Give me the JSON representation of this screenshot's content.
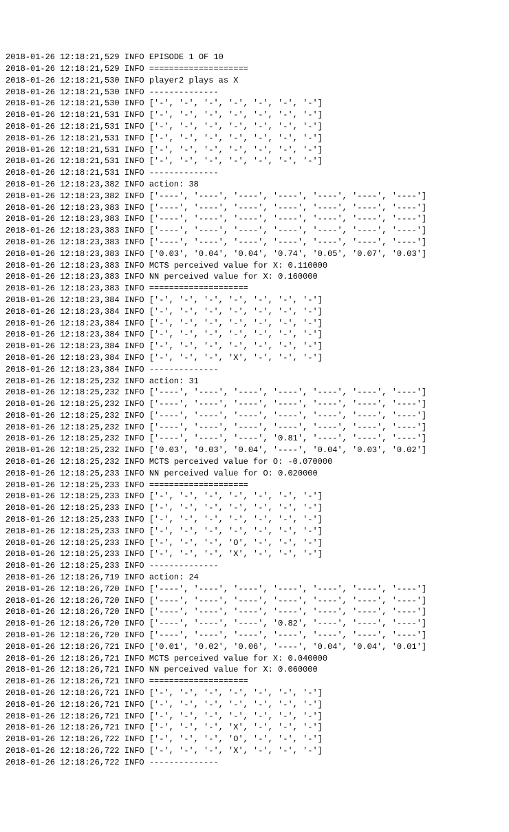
{
  "lines": [
    {
      "ts": "2018-01-26 12:18:21,529",
      "level": "INFO",
      "msg": "EPISODE 1 OF 10"
    },
    {
      "ts": "2018-01-26 12:18:21,529",
      "level": "INFO",
      "msg": "===================="
    },
    {
      "ts": "2018-01-26 12:18:21,530",
      "level": "INFO",
      "msg": "player2 plays as X"
    },
    {
      "ts": "2018-01-26 12:18:21,530",
      "level": "INFO",
      "msg": "--------------"
    },
    {
      "ts": "2018-01-26 12:18:21,530",
      "level": "INFO",
      "msg": "['-', '-', '-', '-', '-', '-', '-']"
    },
    {
      "ts": "2018-01-26 12:18:21,531",
      "level": "INFO",
      "msg": "['-', '-', '-', '-', '-', '-', '-']"
    },
    {
      "ts": "2018-01-26 12:18:21,531",
      "level": "INFO",
      "msg": "['-', '-', '-', '-', '-', '-', '-']"
    },
    {
      "ts": "2018-01-26 12:18:21,531",
      "level": "INFO",
      "msg": "['-', '-', '-', '-', '-', '-', '-']"
    },
    {
      "ts": "2018-01-26 12:18:21,531",
      "level": "INFO",
      "msg": "['-', '-', '-', '-', '-', '-', '-']"
    },
    {
      "ts": "2018-01-26 12:18:21,531",
      "level": "INFO",
      "msg": "['-', '-', '-', '-', '-', '-', '-']"
    },
    {
      "ts": "2018-01-26 12:18:21,531",
      "level": "INFO",
      "msg": "--------------"
    },
    {
      "ts": "2018-01-26 12:18:23,382",
      "level": "INFO",
      "msg": "action: 38"
    },
    {
      "ts": "2018-01-26 12:18:23,382",
      "level": "INFO",
      "msg": "['----', '----', '----', '----', '----', '----', '----']"
    },
    {
      "ts": "2018-01-26 12:18:23,383",
      "level": "INFO",
      "msg": "['----', '----', '----', '----', '----', '----', '----']"
    },
    {
      "ts": "2018-01-26 12:18:23,383",
      "level": "INFO",
      "msg": "['----', '----', '----', '----', '----', '----', '----']"
    },
    {
      "ts": "2018-01-26 12:18:23,383",
      "level": "INFO",
      "msg": "['----', '----', '----', '----', '----', '----', '----']"
    },
    {
      "ts": "2018-01-26 12:18:23,383",
      "level": "INFO",
      "msg": "['----', '----', '----', '----', '----', '----', '----']"
    },
    {
      "ts": "2018-01-26 12:18:23,383",
      "level": "INFO",
      "msg": "['0.03', '0.04', '0.04', '0.74', '0.05', '0.07', '0.03']"
    },
    {
      "ts": "2018-01-26 12:18:23,383",
      "level": "INFO",
      "msg": "MCTS perceived value for X: 0.110000"
    },
    {
      "ts": "2018-01-26 12:18:23,383",
      "level": "INFO",
      "msg": "NN perceived value for X: 0.160000"
    },
    {
      "ts": "2018-01-26 12:18:23,383",
      "level": "INFO",
      "msg": "===================="
    },
    {
      "ts": "2018-01-26 12:18:23,384",
      "level": "INFO",
      "msg": "['-', '-', '-', '-', '-', '-', '-']"
    },
    {
      "ts": "2018-01-26 12:18:23,384",
      "level": "INFO",
      "msg": "['-', '-', '-', '-', '-', '-', '-']"
    },
    {
      "ts": "2018-01-26 12:18:23,384",
      "level": "INFO",
      "msg": "['-', '-', '-', '-', '-', '-', '-']"
    },
    {
      "ts": "2018-01-26 12:18:23,384",
      "level": "INFO",
      "msg": "['-', '-', '-', '-', '-', '-', '-']"
    },
    {
      "ts": "2018-01-26 12:18:23,384",
      "level": "INFO",
      "msg": "['-', '-', '-', '-', '-', '-', '-']"
    },
    {
      "ts": "2018-01-26 12:18:23,384",
      "level": "INFO",
      "msg": "['-', '-', '-', 'X', '-', '-', '-']"
    },
    {
      "ts": "2018-01-26 12:18:23,384",
      "level": "INFO",
      "msg": "--------------"
    },
    {
      "ts": "2018-01-26 12:18:25,232",
      "level": "INFO",
      "msg": "action: 31"
    },
    {
      "ts": "2018-01-26 12:18:25,232",
      "level": "INFO",
      "msg": "['----', '----', '----', '----', '----', '----', '----']"
    },
    {
      "ts": "2018-01-26 12:18:25,232",
      "level": "INFO",
      "msg": "['----', '----', '----', '----', '----', '----', '----']"
    },
    {
      "ts": "2018-01-26 12:18:25,232",
      "level": "INFO",
      "msg": "['----', '----', '----', '----', '----', '----', '----']"
    },
    {
      "ts": "2018-01-26 12:18:25,232",
      "level": "INFO",
      "msg": "['----', '----', '----', '----', '----', '----', '----']"
    },
    {
      "ts": "2018-01-26 12:18:25,232",
      "level": "INFO",
      "msg": "['----', '----', '----', '0.81', '----', '----', '----']"
    },
    {
      "ts": "2018-01-26 12:18:25,232",
      "level": "INFO",
      "msg": "['0.03', '0.03', '0.04', '----', '0.04', '0.03', '0.02']"
    },
    {
      "ts": "2018-01-26 12:18:25,232",
      "level": "INFO",
      "msg": "MCTS perceived value for O: -0.070000"
    },
    {
      "ts": "2018-01-26 12:18:25,233",
      "level": "INFO",
      "msg": "NN perceived value for O: 0.020000"
    },
    {
      "ts": "2018-01-26 12:18:25,233",
      "level": "INFO",
      "msg": "===================="
    },
    {
      "ts": "2018-01-26 12:18:25,233",
      "level": "INFO",
      "msg": "['-', '-', '-', '-', '-', '-', '-']"
    },
    {
      "ts": "2018-01-26 12:18:25,233",
      "level": "INFO",
      "msg": "['-', '-', '-', '-', '-', '-', '-']"
    },
    {
      "ts": "2018-01-26 12:18:25,233",
      "level": "INFO",
      "msg": "['-', '-', '-', '-', '-', '-', '-']"
    },
    {
      "ts": "2018-01-26 12:18:25,233",
      "level": "INFO",
      "msg": "['-', '-', '-', '-', '-', '-', '-']"
    },
    {
      "ts": "2018-01-26 12:18:25,233",
      "level": "INFO",
      "msg": "['-', '-', '-', 'O', '-', '-', '-']"
    },
    {
      "ts": "2018-01-26 12:18:25,233",
      "level": "INFO",
      "msg": "['-', '-', '-', 'X', '-', '-', '-']"
    },
    {
      "ts": "2018-01-26 12:18:25,233",
      "level": "INFO",
      "msg": "--------------"
    },
    {
      "ts": "2018-01-26 12:18:26,719",
      "level": "INFO",
      "msg": "action: 24"
    },
    {
      "ts": "2018-01-26 12:18:26,720",
      "level": "INFO",
      "msg": "['----', '----', '----', '----', '----', '----', '----']"
    },
    {
      "ts": "2018-01-26 12:18:26,720",
      "level": "INFO",
      "msg": "['----', '----', '----', '----', '----', '----', '----']"
    },
    {
      "ts": "2018-01-26 12:18:26,720",
      "level": "INFO",
      "msg": "['----', '----', '----', '----', '----', '----', '----']"
    },
    {
      "ts": "2018-01-26 12:18:26,720",
      "level": "INFO",
      "msg": "['----', '----', '----', '0.82', '----', '----', '----']"
    },
    {
      "ts": "2018-01-26 12:18:26,720",
      "level": "INFO",
      "msg": "['----', '----', '----', '----', '----', '----', '----']"
    },
    {
      "ts": "2018-01-26 12:18:26,721",
      "level": "INFO",
      "msg": "['0.01', '0.02', '0.06', '----', '0.04', '0.04', '0.01']"
    },
    {
      "ts": "2018-01-26 12:18:26,721",
      "level": "INFO",
      "msg": "MCTS perceived value for X: 0.040000"
    },
    {
      "ts": "2018-01-26 12:18:26,721",
      "level": "INFO",
      "msg": "NN perceived value for X: 0.060000"
    },
    {
      "ts": "2018-01-26 12:18:26,721",
      "level": "INFO",
      "msg": "===================="
    },
    {
      "ts": "2018-01-26 12:18:26,721",
      "level": "INFO",
      "msg": "['-', '-', '-', '-', '-', '-', '-']"
    },
    {
      "ts": "2018-01-26 12:18:26,721",
      "level": "INFO",
      "msg": "['-', '-', '-', '-', '-', '-', '-']"
    },
    {
      "ts": "2018-01-26 12:18:26,721",
      "level": "INFO",
      "msg": "['-', '-', '-', '-', '-', '-', '-']"
    },
    {
      "ts": "2018-01-26 12:18:26,721",
      "level": "INFO",
      "msg": "['-', '-', '-', 'X', '-', '-', '-']"
    },
    {
      "ts": "2018-01-26 12:18:26,722",
      "level": "INFO",
      "msg": "['-', '-', '-', 'O', '-', '-', '-']"
    },
    {
      "ts": "2018-01-26 12:18:26,722",
      "level": "INFO",
      "msg": "['-', '-', '-', 'X', '-', '-', '-']"
    },
    {
      "ts": "2018-01-26 12:18:26,722",
      "level": "INFO",
      "msg": "--------------"
    }
  ]
}
